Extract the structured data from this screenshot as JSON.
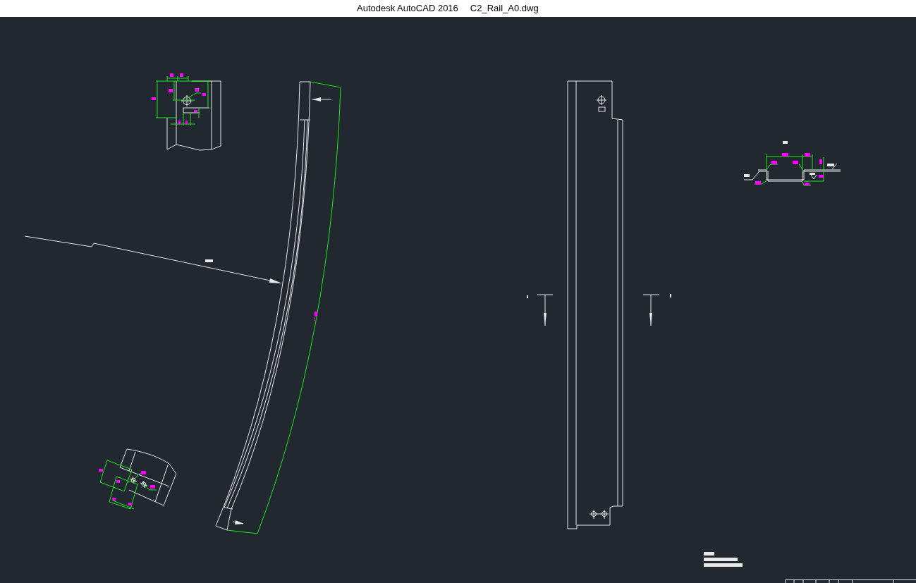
{
  "window": {
    "app_name": "Autodesk AutoCAD 2016",
    "file_name": "C2_Rail_A0.dwg"
  }
}
